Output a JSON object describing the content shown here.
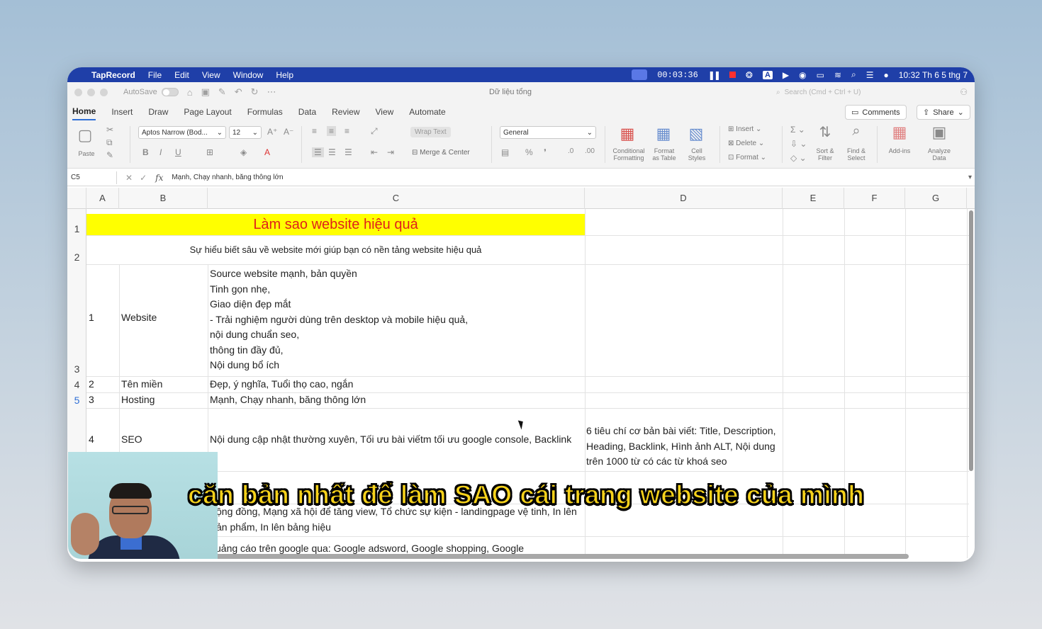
{
  "menubar": {
    "app_name": "TapRecord",
    "items": [
      "File",
      "Edit",
      "View",
      "Window",
      "Help"
    ],
    "timer": "00:03:36",
    "clock": "10:32 Th 6 5 thg 7"
  },
  "qat": {
    "autosave_label": "AutoSave",
    "doc_title": "Dữ liệu tổng",
    "search_placeholder": "Search (Cmd + Ctrl + U)"
  },
  "tabs": {
    "items": [
      "Home",
      "Insert",
      "Draw",
      "Page Layout",
      "Formulas",
      "Data",
      "Review",
      "View",
      "Automate"
    ],
    "comments_label": "Comments",
    "share_label": "Share"
  },
  "ribbon": {
    "paste_label": "Paste",
    "font_name": "Aptos Narrow (Bod...",
    "font_size": "12",
    "wrap_text": "Wrap Text",
    "merge_center": "Merge & Center",
    "number_format": "General",
    "conditional_formatting": "Conditional Formatting",
    "format_as_table": "Format as Table",
    "cell_styles": "Cell Styles",
    "insert": "Insert",
    "delete": "Delete",
    "format": "Format",
    "sort_filter": "Sort & Filter",
    "find_select": "Find & Select",
    "add_ins": "Add-ins",
    "analyze_data": "Analyze Data"
  },
  "formula_bar": {
    "name_box": "C5",
    "content": "Mạnh, Chạy nhanh, băng thông lớn"
  },
  "columns": [
    "A",
    "B",
    "C",
    "D",
    "E",
    "F",
    "G"
  ],
  "rows": [
    "1",
    "2",
    "3",
    "4",
    "5"
  ],
  "sheet": {
    "title": "Làm sao website hiệu quả",
    "subtitle": "Sự hiểu biết sâu về website mới giúp bạn có nền tảng website hiệu quả",
    "r3": {
      "a": "1",
      "b": "Website",
      "c": [
        "Source website mạnh, bản quyền",
        "Tinh gọn nhẹ,",
        "Giao diện đẹp mắt",
        "- Trải nghiệm người dùng trên desktop và mobile hiệu quả,",
        "nội dung chuẩn seo,",
        "thông tin đầy đủ,",
        "Nội dung bổ ích"
      ]
    },
    "r4": {
      "a": "2",
      "b": "Tên miền",
      "c": "Đẹp, ý nghĩa, Tuổi thọ cao, ngắn"
    },
    "r5": {
      "a": "3",
      "b": "Hosting",
      "c": "Mạnh, Chạy nhanh, băng thông lớn"
    },
    "r6": {
      "a": "4",
      "b": "SEO",
      "c": "Nội dung cập nhật thường xuyên, Tối ưu bài viếtm tối ưu google console, Backlink",
      "d": [
        "6 tiêu chí cơ bản bài viết: Title, Description,",
        "Heading, Backlink, Hình ảnh ALT, Nội dung",
        "trên 1000 từ có các từ khoá seo"
      ]
    },
    "r7": {
      "c": [
        "uảng cáo trên google qua: Google adsword, Google shopping, Google",
        "",
        "ộng đồng, Mạng xã hội để tăng view, Tổ chức sự kiện - landingpage vệ tinh, In lên",
        "ản phẩm, In lên bảng hiệu"
      ]
    }
  },
  "subtitle_caption": "căn bản nhất để làm SAO cái trang website của mình",
  "colors": {
    "menubar": "#1f3fa8",
    "title_fill": "#ffff00",
    "title_text": "#e0201a",
    "caption": "#f6d21b"
  }
}
